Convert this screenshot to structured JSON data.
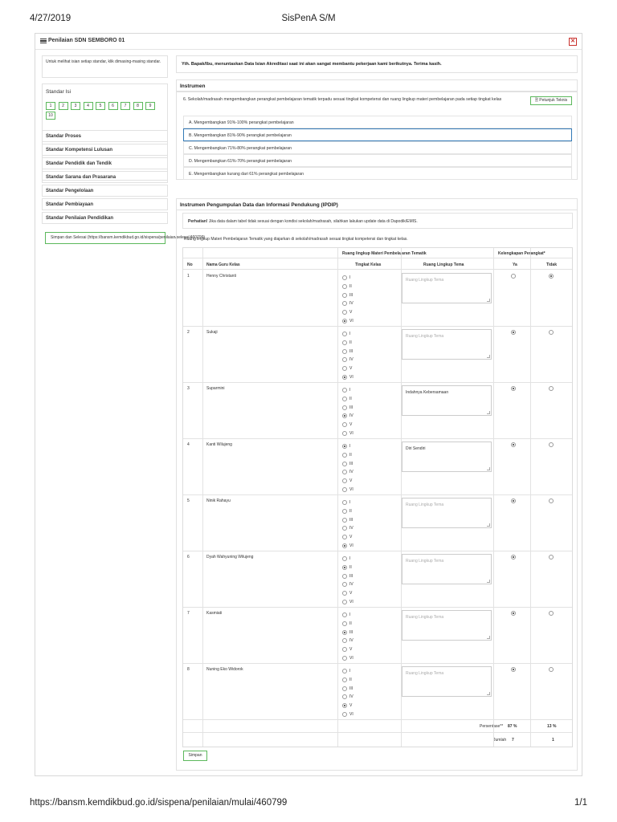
{
  "print": {
    "date": "4/27/2019",
    "title": "SisPenA S/M",
    "url": "https://bansm.kemdikbud.go.id/sispena/penilaian/mulai/460799",
    "page": "1/1"
  },
  "panel": {
    "title": "Penilaian SDN SEMBORO 01",
    "close_icon": "close-icon",
    "list_icon": "list-icon"
  },
  "sidebar": {
    "note": "Untuk melihat isian setiap standar, klik dimasing-masing standar.",
    "standar_isi_label": "Standar Isi",
    "pages": [
      "1",
      "2",
      "3",
      "4",
      "5",
      "6",
      "7",
      "8",
      "9",
      "10"
    ],
    "items": [
      "Standar Proses",
      "Standar Kompetensi Lulusan",
      "Standar Pendidik dan Tendik",
      "Standar Sarana dan Prasarana",
      "Standar Pengelolaan",
      "Standar Pembiayaan",
      "Standar Penilaian Pendidikan"
    ],
    "save_exit": "Simpan dan Selesai (https://bansm.kemdikbud.go.id/sispena/penilaian/selesai/460799)"
  },
  "main": {
    "greeting": "Yth. Bapak/Ibu, menuntaskan Data Isian Akreditasi saat ini akan sangat membantu pekerjaan kami berikutnya. Terima kasih.",
    "instrumen_title": "Instrumen",
    "question": "6. Sekolah/madrasah mengembangkan perangkat pembelajaran tematik terpadu sesuai tingkat kompetensi dan ruang lingkup materi pembelajaran pada setiap tingkat kelas",
    "guide_button": "Petunjuk Teknis",
    "options": [
      "A. Mengembangkan 91%-100% perangkat pembelajaran",
      "B. Mengembangkan 81%-90% perangkat pembelajaran",
      "C. Mengembangkan 71%-80% perangkat pembelajaran",
      "D. Mengembangkan 61%-70% perangkat pembelajaran",
      "E. Mengembangkan kurang dari 61% perangkat pembelajaran"
    ],
    "selected_option": 1,
    "ipdip_title": "Instrumen Pengumpulan Data dan Informasi Pendukung (IPDIP)",
    "attention_label": "Perhatian!",
    "attention_text": "Jika data dalam tabel tidak sesuai dengan kondisi sekolah/madrasah, silahkan lakukan update data di Dapodik/EMIS.",
    "table_desc": "Ruang lingkup Materi Pembelajaran Tematik yang diajarkan di sekolah/madrasah sesuai tingkat kompetensi dan tingkat kelas.",
    "save_button": "Simpan"
  },
  "table": {
    "header_group": "Ruang lingkup Materi Pembelajaran Tematik",
    "header_kelengkapan": "Kelengkapan Perangkat*",
    "col_no": "No",
    "col_nama": "Nama Guru Kelas",
    "col_tingkat": "Tingkat Kelas",
    "col_tema": "Ruang Lingkup Tema",
    "col_ya": "Ya",
    "col_tidak": "Tidak",
    "levels": [
      "I",
      "II",
      "III",
      "IV",
      "V",
      "VI"
    ],
    "placeholder": "Ruang Lingkup Tema",
    "rows": [
      {
        "no": "1",
        "name": "Henny Christanti",
        "level": 5,
        "tema": "",
        "ya": false
      },
      {
        "no": "2",
        "name": "Sukaji",
        "level": 5,
        "tema": "",
        "ya": true
      },
      {
        "no": "3",
        "name": "Suparmini",
        "level": 3,
        "tema": "Indahnya Kebersamaan",
        "ya": true
      },
      {
        "no": "4",
        "name": "Kanti Wilujeng",
        "level": 0,
        "tema": "Diri Sendiri",
        "ya": true
      },
      {
        "no": "5",
        "name": "Ninik Rahayu",
        "level": 5,
        "tema": "",
        "ya": true
      },
      {
        "no": "6",
        "name": "Dyah Wahyuning Wilujeng",
        "level": 1,
        "tema": "",
        "ya": true
      },
      {
        "no": "7",
        "name": "Kasmiati",
        "level": 2,
        "tema": "",
        "ya": true
      },
      {
        "no": "8",
        "name": "Nuning Eko Widorok",
        "level": 4,
        "tema": "",
        "ya": true
      }
    ],
    "persentase_label": "Persentase**",
    "persentase_ya": "87 %",
    "persentase_tidak": "13 %",
    "jumlah_label": "Jumlah",
    "jumlah_ya": "7",
    "jumlah_tidak": "1"
  }
}
